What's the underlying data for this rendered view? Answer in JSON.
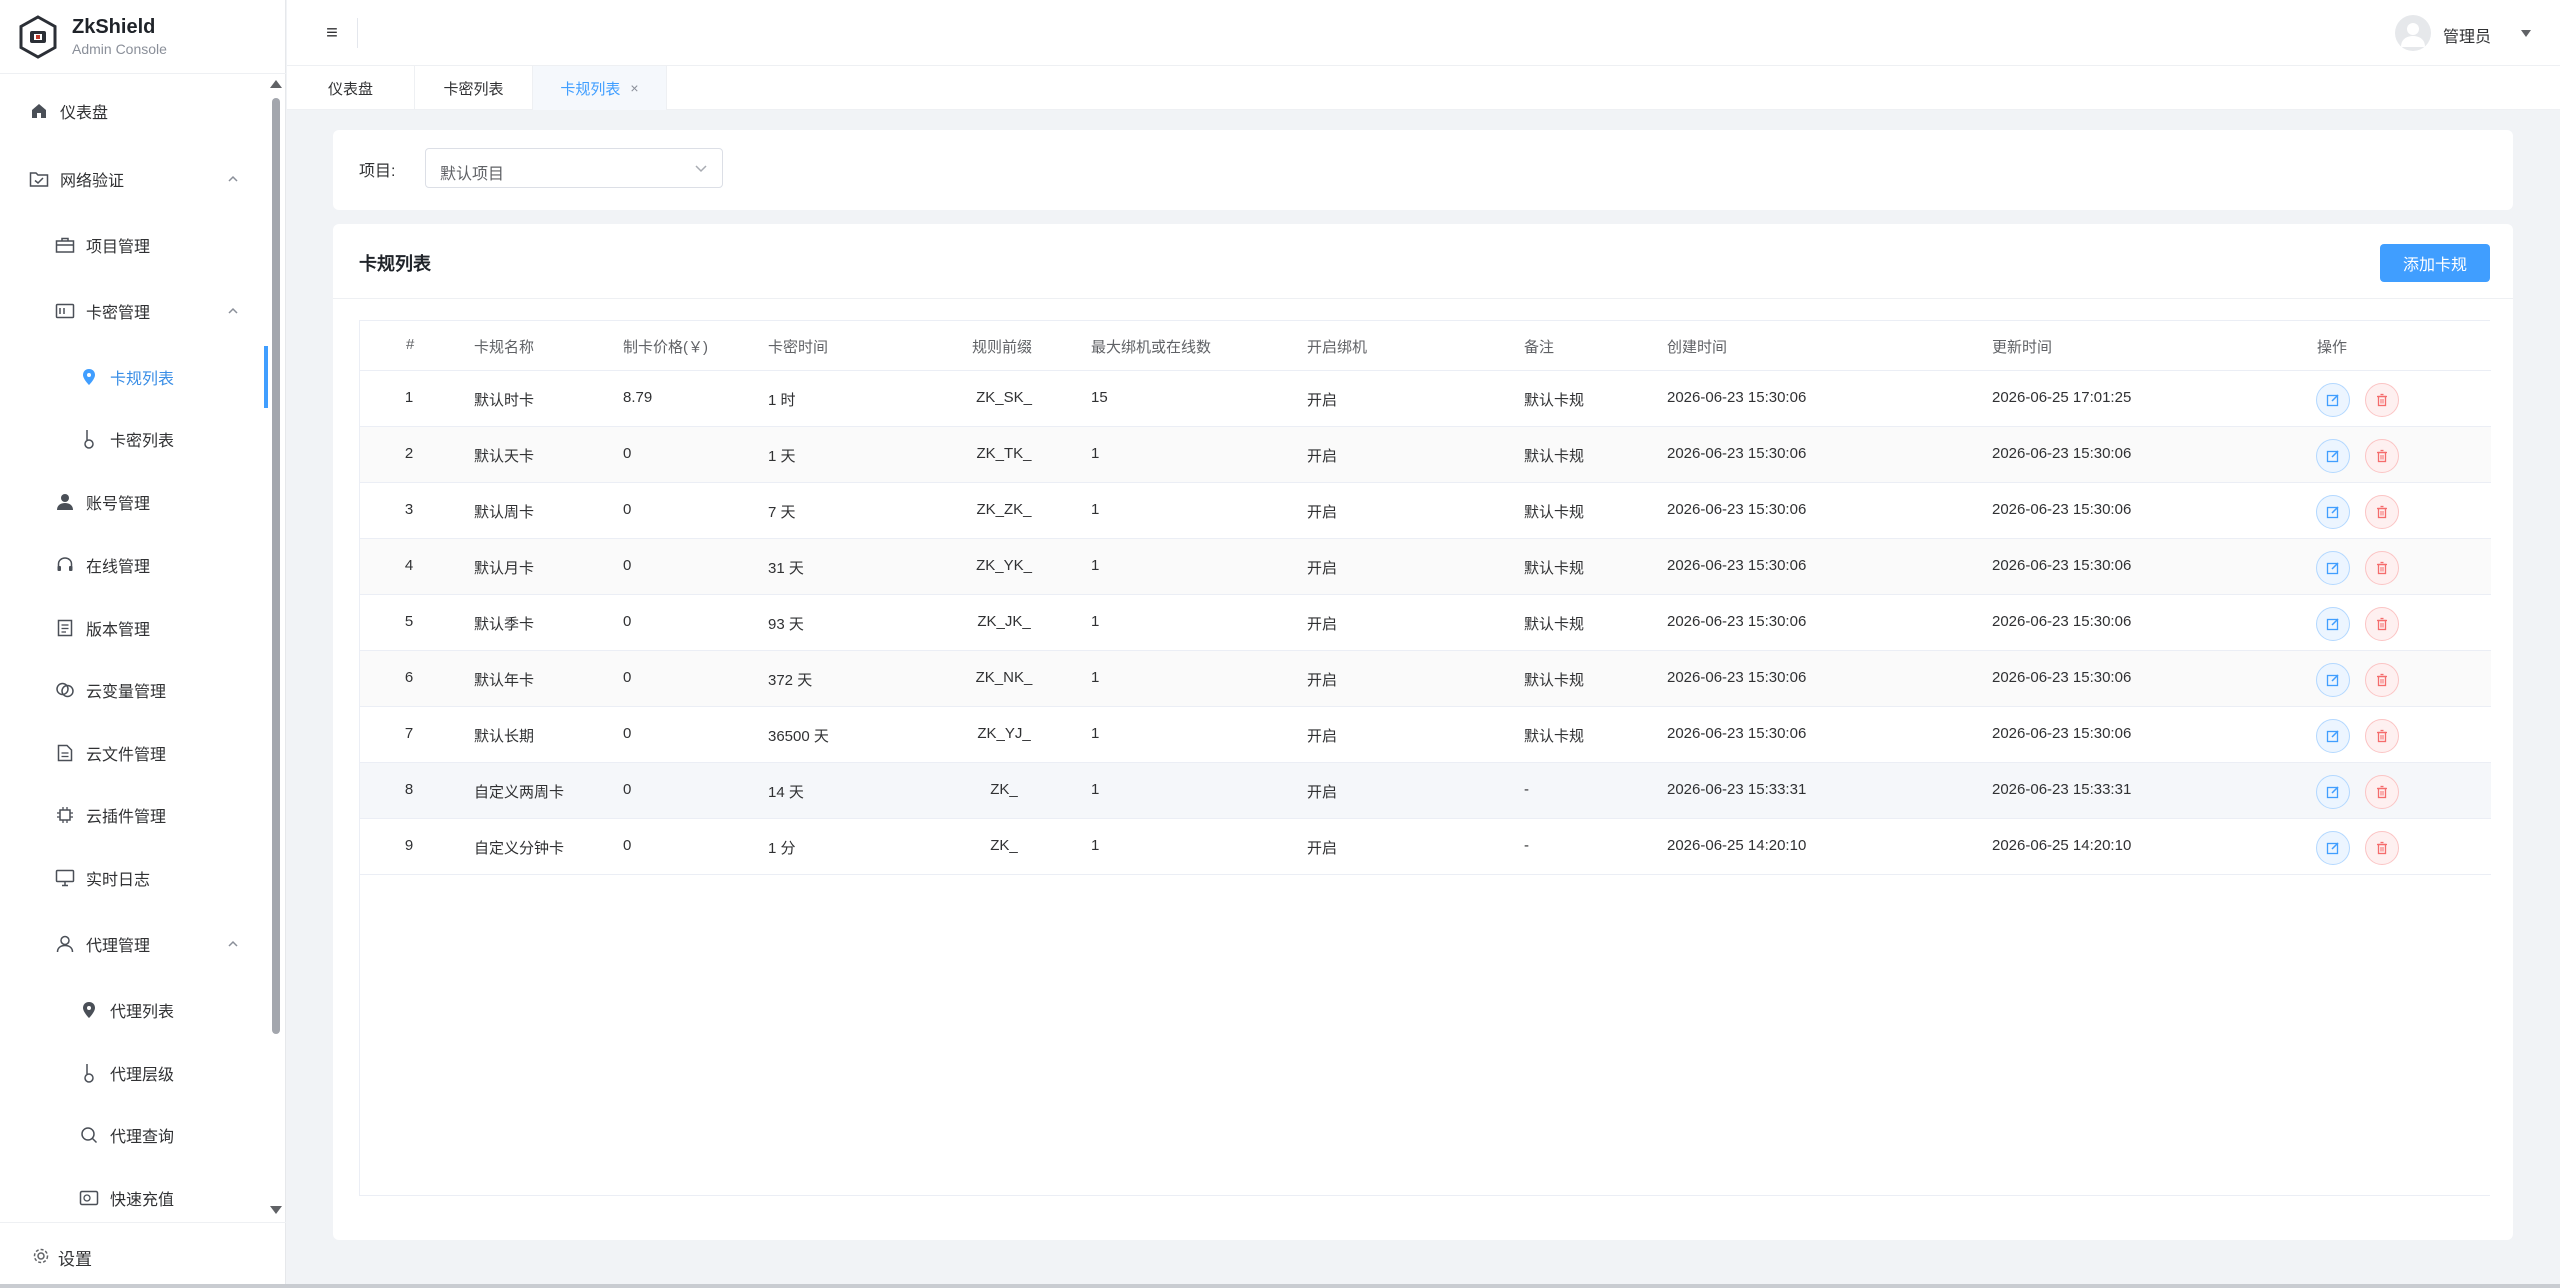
{
  "brand": {
    "title": "ZkShield",
    "subtitle": "Admin Console"
  },
  "sidebar": {
    "items": [
      {
        "label": "仪表盘",
        "icon": "home-icon"
      },
      {
        "label": "网络验证",
        "icon": "folder-check-icon",
        "expanded": true
      },
      {
        "label": "项目管理",
        "icon": "briefcase-icon"
      },
      {
        "label": "卡密管理",
        "icon": "card-icon",
        "expanded": true
      },
      {
        "label": "卡规列表",
        "icon": "pin-icon",
        "active": true
      },
      {
        "label": "卡密列表",
        "icon": "key-icon"
      },
      {
        "label": "账号管理",
        "icon": "user-icon"
      },
      {
        "label": "在线管理",
        "icon": "headset-icon"
      },
      {
        "label": "版本管理",
        "icon": "document-icon"
      },
      {
        "label": "云变量管理",
        "icon": "cloud-variable-icon"
      },
      {
        "label": "云文件管理",
        "icon": "file-icon"
      },
      {
        "label": "云插件管理",
        "icon": "chip-icon"
      },
      {
        "label": "实时日志",
        "icon": "monitor-icon"
      },
      {
        "label": "代理管理",
        "icon": "user-outline-icon",
        "expanded": true
      },
      {
        "label": "代理列表",
        "icon": "pin-icon"
      },
      {
        "label": "代理层级",
        "icon": "key-icon"
      },
      {
        "label": "代理查询",
        "icon": "search-icon"
      },
      {
        "label": "快速充值",
        "icon": "wallet-icon"
      }
    ],
    "settings_label": "设置"
  },
  "header": {
    "user_name": "管理员"
  },
  "tabs": [
    {
      "label": "仪表盘"
    },
    {
      "label": "卡密列表"
    },
    {
      "label": "卡规列表",
      "active": true,
      "close": "×"
    }
  ],
  "filter": {
    "label": "项目:",
    "selected": "默认项目"
  },
  "card": {
    "title": "卡规列表",
    "add_button": "添加卡规"
  },
  "table": {
    "columns": [
      "#",
      "卡规名称",
      "制卡价格(￥)",
      "卡密时间",
      "规则前缀",
      "最大绑机或在线数",
      "开启绑机",
      "备注",
      "创建时间",
      "更新时间",
      "操作"
    ],
    "rows": [
      [
        "1",
        "默认时卡",
        "8.79",
        "1 时",
        "ZK_SK_",
        "15",
        "开启",
        "默认卡规",
        "2026-06-23 15:30:06",
        "2026-06-25 17:01:25"
      ],
      [
        "2",
        "默认天卡",
        "0",
        "1 天",
        "ZK_TK_",
        "1",
        "开启",
        "默认卡规",
        "2026-06-23 15:30:06",
        "2026-06-23 15:30:06"
      ],
      [
        "3",
        "默认周卡",
        "0",
        "7 天",
        "ZK_ZK_",
        "1",
        "开启",
        "默认卡规",
        "2026-06-23 15:30:06",
        "2026-06-23 15:30:06"
      ],
      [
        "4",
        "默认月卡",
        "0",
        "31 天",
        "ZK_YK_",
        "1",
        "开启",
        "默认卡规",
        "2026-06-23 15:30:06",
        "2026-06-23 15:30:06"
      ],
      [
        "5",
        "默认季卡",
        "0",
        "93 天",
        "ZK_JK_",
        "1",
        "开启",
        "默认卡规",
        "2026-06-23 15:30:06",
        "2026-06-23 15:30:06"
      ],
      [
        "6",
        "默认年卡",
        "0",
        "372 天",
        "ZK_NK_",
        "1",
        "开启",
        "默认卡规",
        "2026-06-23 15:30:06",
        "2026-06-23 15:30:06"
      ],
      [
        "7",
        "默认长期",
        "0",
        "36500 天",
        "ZK_YJ_",
        "1",
        "开启",
        "默认卡规",
        "2026-06-23 15:30:06",
        "2026-06-23 15:30:06"
      ],
      [
        "8",
        "自定义两周卡",
        "0",
        "14 天",
        "ZK_",
        "1",
        "开启",
        "-",
        "2026-06-23 15:33:31",
        "2026-06-23 15:33:31"
      ],
      [
        "9",
        "自定义分钟卡",
        "0",
        "1 分",
        "ZK_",
        "1",
        "开启",
        "-",
        "2026-06-25 14:20:10",
        "2026-06-25 14:20:10"
      ]
    ]
  },
  "colors": {
    "accent": "#409eff",
    "danger": "#f56c6c",
    "sidebar_bg": "#ffffff",
    "page_bg": "#f1f3f6"
  }
}
